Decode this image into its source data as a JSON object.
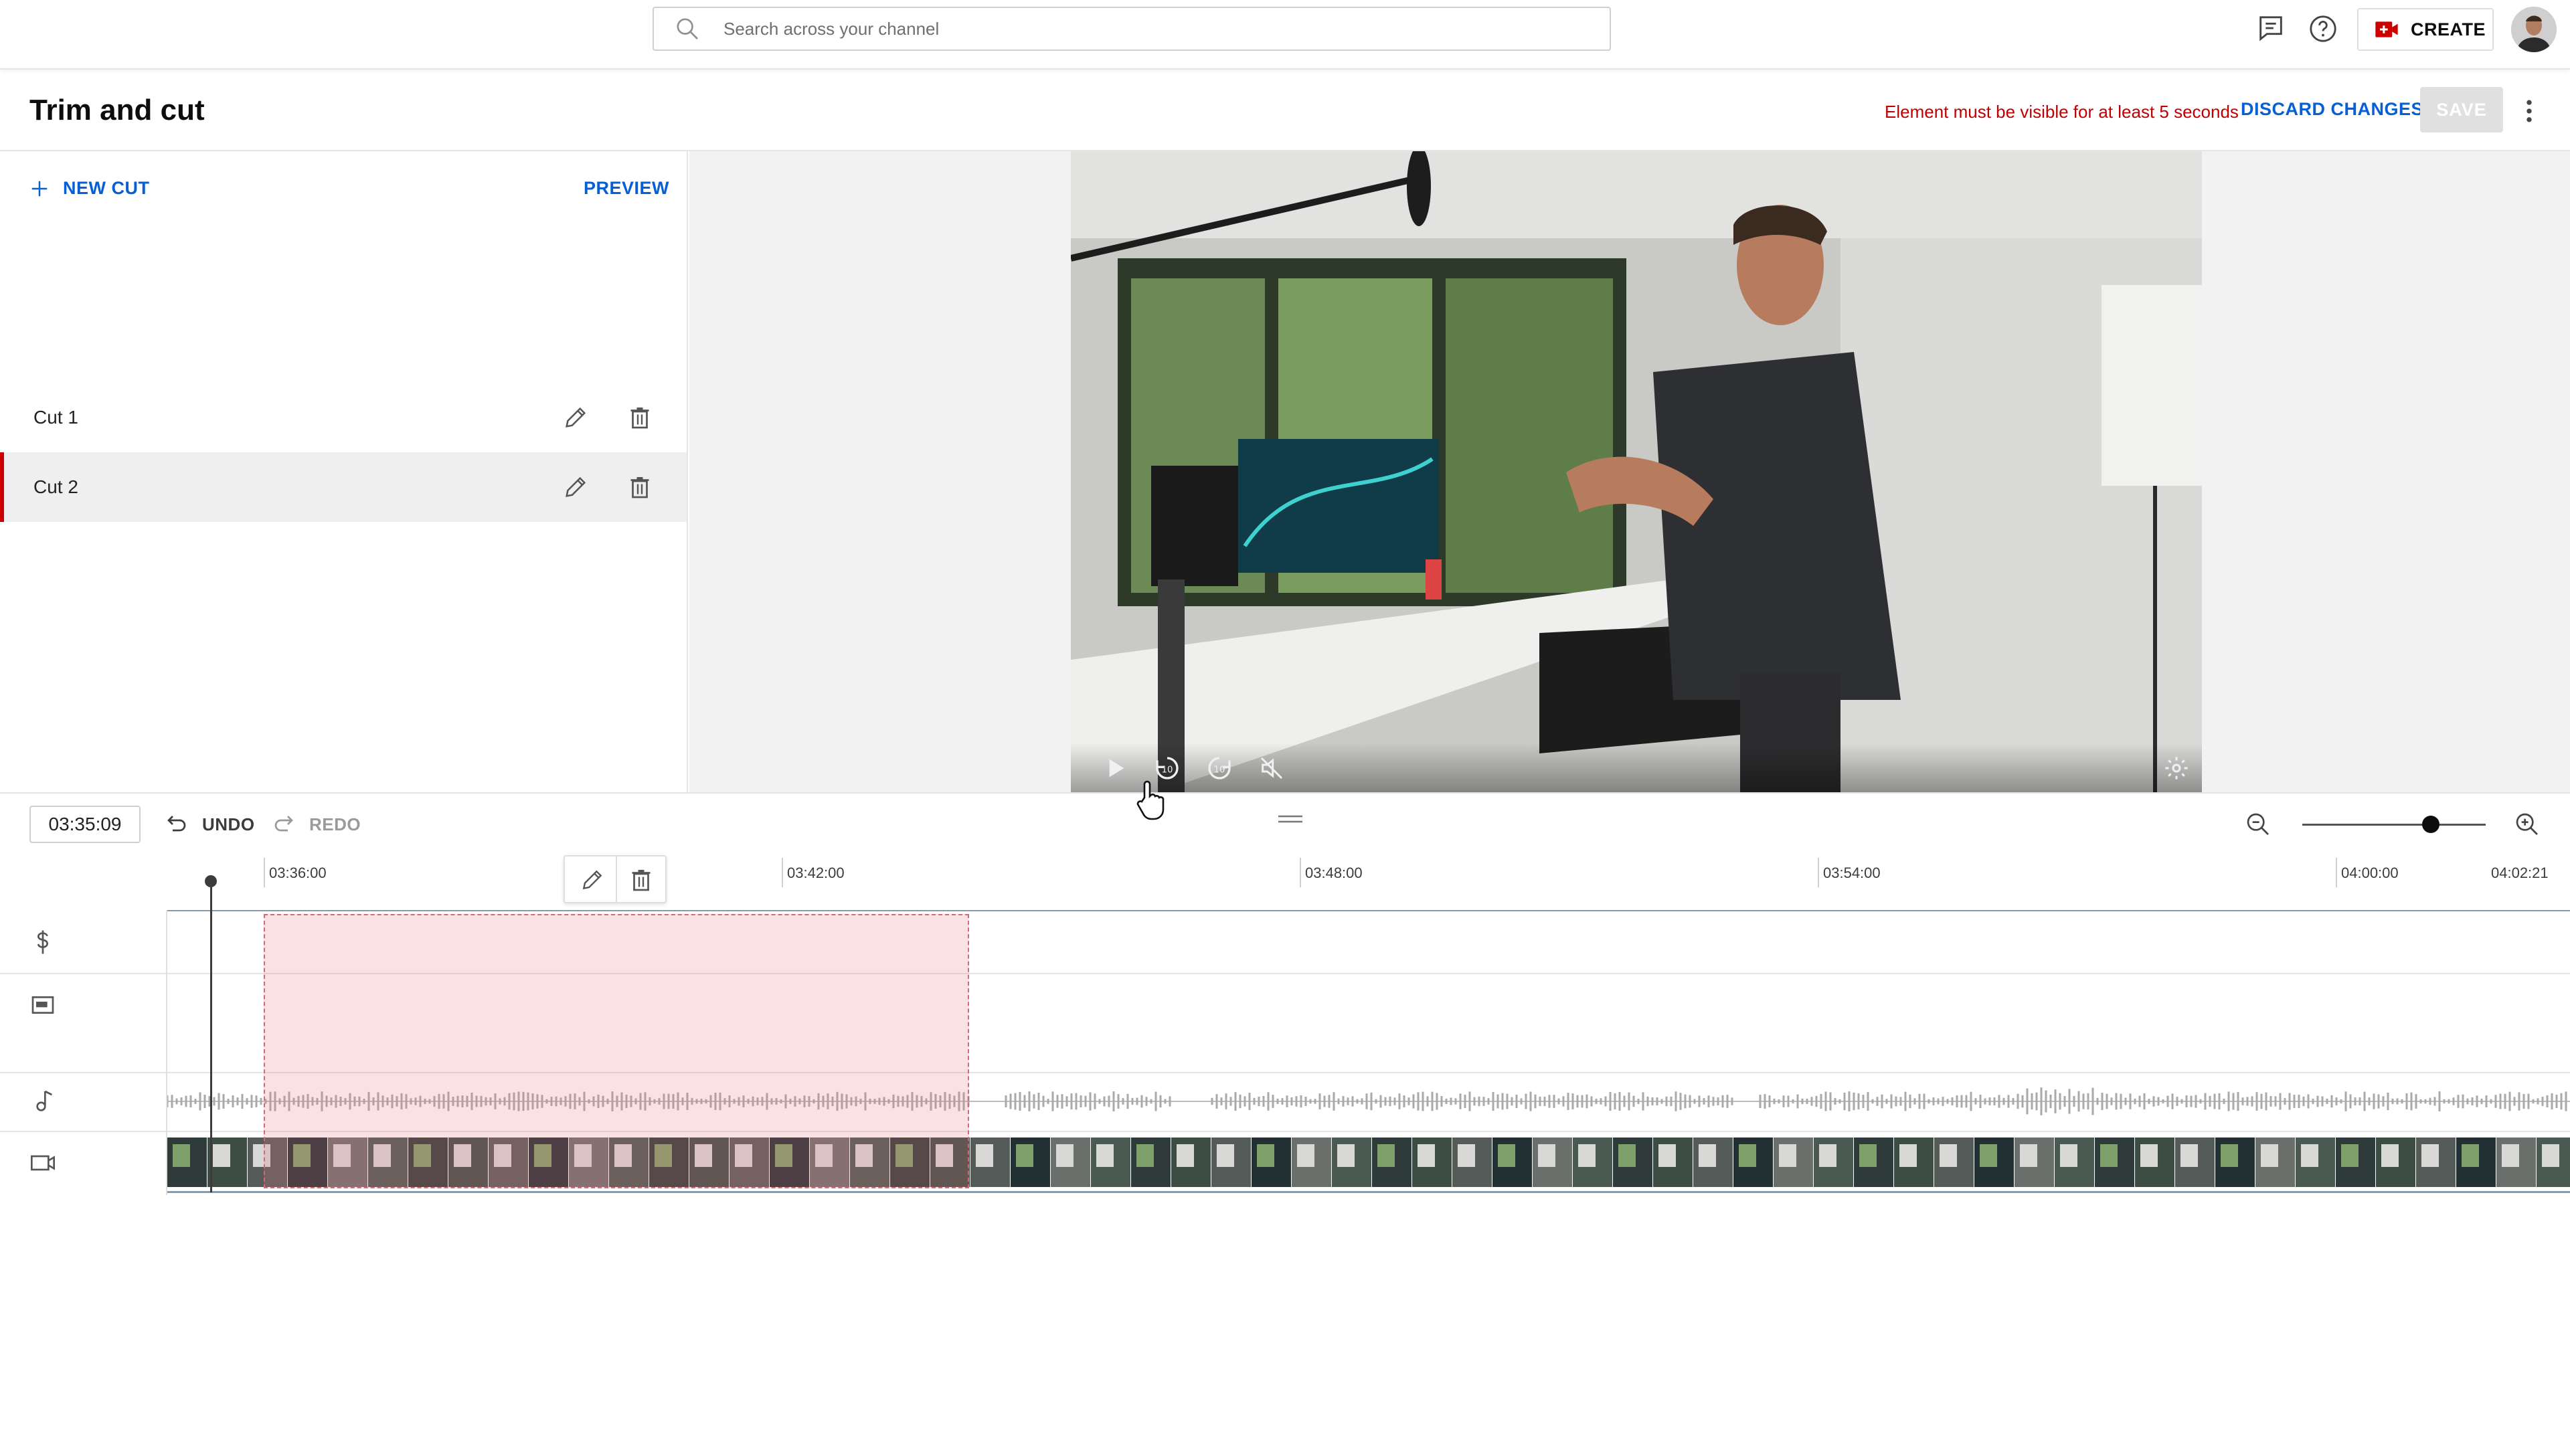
{
  "search": {
    "placeholder": "Search across your channel"
  },
  "topbar": {
    "create_label": "CREATE",
    "icons": [
      "feedback-icon",
      "help-icon",
      "create-video-icon",
      "avatar"
    ]
  },
  "header": {
    "title": "Trim and cut",
    "error_message": "Element must be visible for at least 5 seconds",
    "discard_label": "DISCARD CHANGES",
    "save_label": "SAVE"
  },
  "cuts_panel": {
    "new_cut_label": "NEW CUT",
    "preview_label": "PREVIEW",
    "cuts": [
      {
        "label": "Cut 1",
        "active": false
      },
      {
        "label": "Cut 2",
        "active": true
      }
    ]
  },
  "player": {
    "controls": [
      "play-icon",
      "rewind-10-icon",
      "forward-10-icon",
      "mute-icon",
      "settings-icon"
    ]
  },
  "timeline": {
    "timecode": "03:35:09",
    "undo_label": "UNDO",
    "redo_label": "REDO",
    "zoom_level": 0.7,
    "ruler": [
      "03:36:00",
      "03:42:00",
      "03:48:00",
      "03:54:00",
      "04:00:00",
      "04:02:21"
    ],
    "tracks": [
      "monetization-track-icon",
      "captions-track-icon",
      "audio-track-icon",
      "video-track-icon"
    ],
    "selected_cut": {
      "label": "Cut 2"
    }
  },
  "colors": {
    "accent": "#065fd4",
    "error": "#c00000",
    "cut_region": "#f3c8cd",
    "brand_red": "#cc0000"
  }
}
